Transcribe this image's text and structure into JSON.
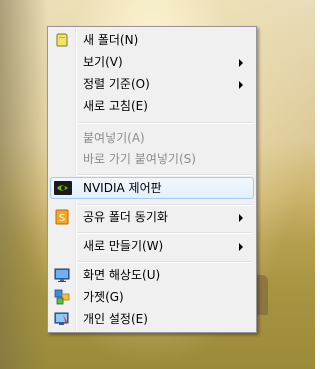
{
  "menu": {
    "items": [
      {
        "label": "새 폴더(N)",
        "icon": "new-folder-icon",
        "submenu": false,
        "enabled": true
      },
      {
        "label": "보기(V)",
        "submenu": true,
        "enabled": true
      },
      {
        "label": "정렬 기준(O)",
        "submenu": true,
        "enabled": true
      },
      {
        "label": "새로 고침(E)",
        "submenu": false,
        "enabled": true
      },
      {
        "label": "붙여넣기(A)",
        "submenu": false,
        "enabled": false
      },
      {
        "label": "바로 가기 붙여넣기(S)",
        "submenu": false,
        "enabled": false
      },
      {
        "label": "NVIDIA 제어판",
        "icon": "nvidia-icon",
        "submenu": false,
        "enabled": true,
        "highlighted": true
      },
      {
        "label": "공유 폴더 동기화",
        "icon": "sync-icon",
        "submenu": true,
        "enabled": true
      },
      {
        "label": "새로 만들기(W)",
        "submenu": true,
        "enabled": true
      },
      {
        "label": "화면 해상도(U)",
        "icon": "display-resolution-icon",
        "submenu": false,
        "enabled": true
      },
      {
        "label": "가젯(G)",
        "icon": "gadgets-icon",
        "submenu": false,
        "enabled": true
      },
      {
        "label": "개인 설정(E)",
        "icon": "personalize-icon",
        "submenu": false,
        "enabled": true
      }
    ]
  },
  "colors": {
    "menu_background": "#f0f0f0",
    "highlight_border": "#a9c9ec",
    "disabled_text": "#8d8d8d"
  }
}
